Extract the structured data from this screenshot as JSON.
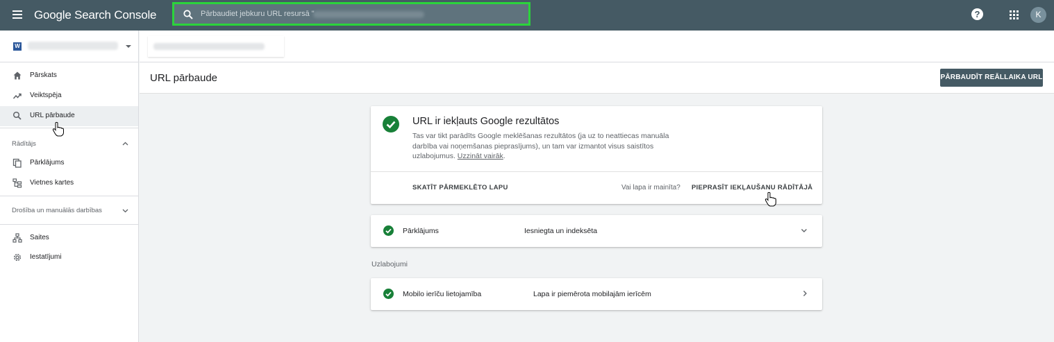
{
  "app": {
    "title": "Google Search Console",
    "search_placeholder": "Pārbaudiet jebkuru URL resursā \"",
    "avatar_letter": "K",
    "help_symbol": "?",
    "accent_color": "#455a64",
    "success_color": "#188038"
  },
  "sidebar": {
    "property_logo": "W",
    "items": [
      {
        "label": "Pārskats",
        "icon": "home-icon"
      },
      {
        "label": "Veiktspēja",
        "icon": "trending-up-icon"
      },
      {
        "label": "URL pārbaude",
        "icon": "search-icon",
        "active": true
      },
      {
        "label": "Pārklājums",
        "icon": "file-copy-icon"
      },
      {
        "label": "Vietnes kartes",
        "icon": "sitemap-icon"
      },
      {
        "label": "Saites",
        "icon": "links-icon"
      },
      {
        "label": "Iestatījumi",
        "icon": "gear-icon"
      }
    ],
    "sections": [
      {
        "title": "Rādītājs",
        "state": "expanded"
      },
      {
        "title": "Drošība un manuālās darbības",
        "state": "collapsed"
      }
    ]
  },
  "page": {
    "title": "URL pārbaude",
    "live_test_button": "PĀRBAUDĪT REĀLLAIKA URL"
  },
  "result_card": {
    "title": "URL ir iekļauts Google rezultātos",
    "description": "Tas var tikt parādīts Google meklēšanas rezultātos (ja uz to neattiecas manuāla darbība vai noņemšanas pieprasījums), un tam var izmantot visus saistītos uzlabojumus. ",
    "learn_more": "Uzzināt vairāk",
    "learn_more_suffix": ".",
    "view_crawled": "SKATĪT PĀRMEKLĒTO LAPU",
    "changed_question": "Vai lapa ir mainīta?",
    "request_indexing": "PIEPRASĪT IEKĻAUŠANU RĀDĪTĀJĀ"
  },
  "coverage": {
    "label": "Pārklājums",
    "value": "Iesniegta un indeksēta"
  },
  "enhancements": {
    "group_label": "Uzlabojumi",
    "items": [
      {
        "label": "Mobilo ierīču lietojamība",
        "value": "Lapa ir piemērota mobilajām ierīcēm"
      }
    ]
  }
}
